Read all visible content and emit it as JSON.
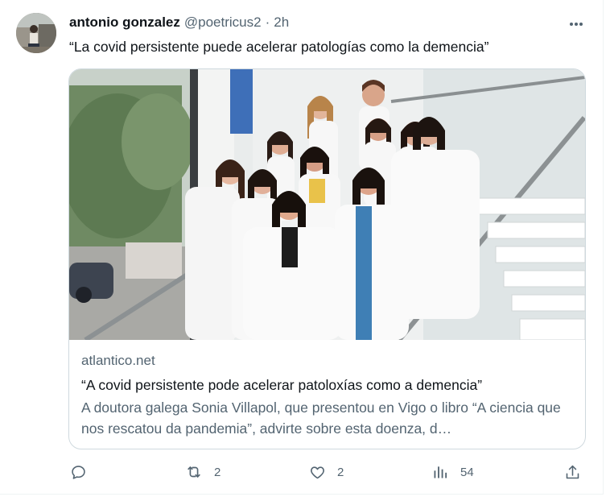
{
  "tweet": {
    "author_name": "antonio gonzalez",
    "handle": "@poetricus2",
    "separator": "·",
    "time": "2h",
    "text": "“La covid persistente puede acelerar patologías como la demencia”"
  },
  "card": {
    "domain": "atlantico.net",
    "title": "“A covid persistente pode acelerar patoloxías como a demencia”",
    "description": "A doutora galega Sonia Villapol, que presentou en Vigo o libro “A ciencia que nos rescatou da pandemia”, advirte sobre esta doenza, d…",
    "image_icon": "group-photo-scientists-on-stairs"
  },
  "actions": {
    "reply": {
      "icon": "reply-icon",
      "count": ""
    },
    "retweet": {
      "icon": "retweet-icon",
      "count": "2"
    },
    "like": {
      "icon": "heart-icon",
      "count": "2"
    },
    "views": {
      "icon": "views-icon",
      "count": "54"
    },
    "share": {
      "icon": "share-icon",
      "count": ""
    }
  },
  "colors": {
    "text_primary": "#0f1419",
    "text_secondary": "#536471",
    "border": "#cfd9de"
  }
}
